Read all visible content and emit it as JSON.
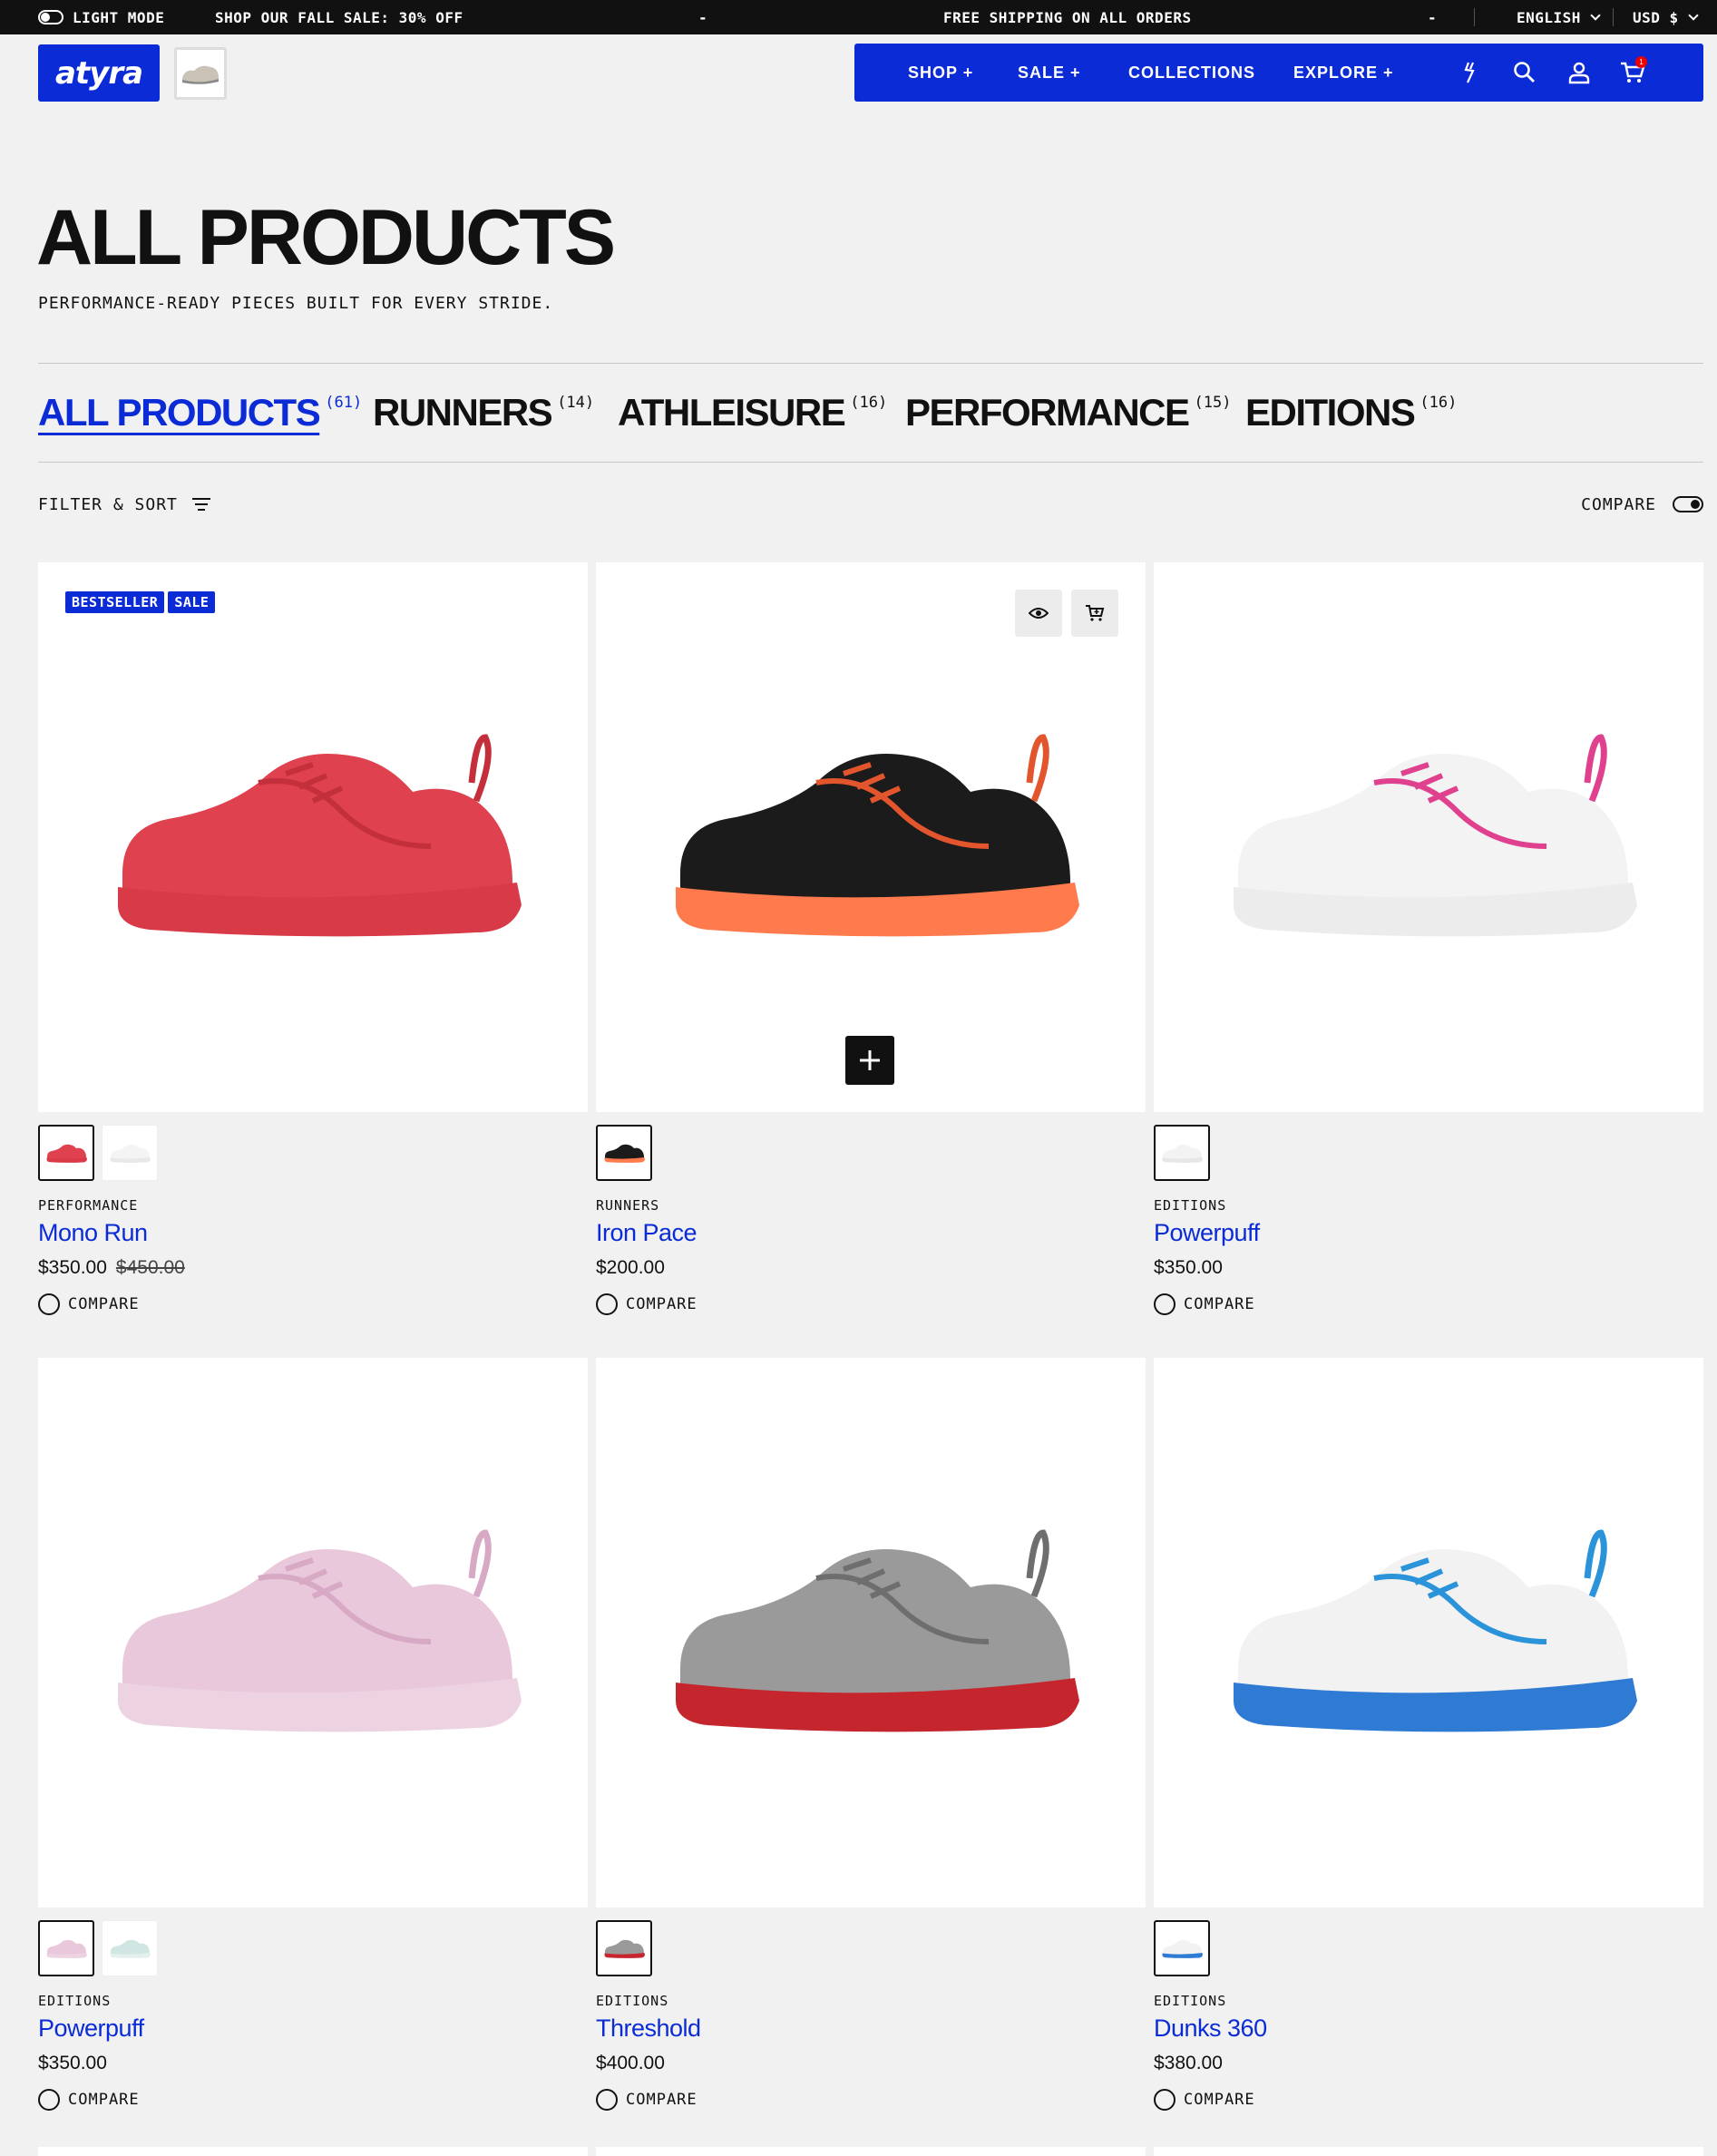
{
  "announcement": {
    "light_mode": "LIGHT MODE",
    "sale": "SHOP OUR FALL SALE: 30% OFF",
    "dash1": "-",
    "shipping": "FREE SHIPPING ON ALL ORDERS",
    "dash2": "-",
    "language": "ENGLISH",
    "currency": "USD $"
  },
  "header": {
    "logo_text": "atyra",
    "nav": [
      "SHOP +",
      "SALE +",
      "COLLECTIONS",
      "EXPLORE +"
    ],
    "cart_count": "1",
    "icons": [
      "lightning-icon",
      "search-icon",
      "account-icon",
      "cart-icon"
    ]
  },
  "page": {
    "title": "ALL PRODUCTS",
    "subtitle": "PERFORMANCE-READY PIECES BUILT FOR EVERY STRIDE."
  },
  "tabs": [
    {
      "label": "ALL PRODUCTS",
      "count": "(61)",
      "active": true
    },
    {
      "label": "RUNNERS",
      "count": "(14)",
      "active": false
    },
    {
      "label": "ATHLEISURE",
      "count": "(16)",
      "active": false
    },
    {
      "label": "PERFORMANCE",
      "count": "(15)",
      "active": false
    },
    {
      "label": "EDITIONS",
      "count": "(16)",
      "active": false
    }
  ],
  "toolbar": {
    "filter_label": "FILTER & SORT",
    "compare_label": "COMPARE"
  },
  "products": [
    {
      "category": "PERFORMANCE",
      "name": "Mono Run",
      "price": "$350.00",
      "old_price": "$450.00",
      "compare": "COMPARE",
      "badges": [
        "BESTSELLER",
        "SALE"
      ],
      "upper": "#e0414f",
      "sole": "#d83a47",
      "accent": "#c32f3b",
      "swatches": [
        [
          "#e0414f",
          "#d83a47"
        ],
        [
          "#f4f4f4",
          "#e8e8e8"
        ]
      ]
    },
    {
      "category": "RUNNERS",
      "name": "Iron Pace",
      "price": "$200.00",
      "old_price": "",
      "compare": "COMPARE",
      "badges": [],
      "upper": "#1b1b1b",
      "sole": "#ff7a4c",
      "accent": "#e2552d",
      "swatches": [
        [
          "#1b1b1b",
          "#ff7a4c"
        ]
      ]
    },
    {
      "category": "EDITIONS",
      "name": "Powerpuff",
      "price": "$350.00",
      "old_price": "",
      "compare": "COMPARE",
      "badges": [],
      "upper": "#f3f3f3",
      "sole": "#ececec",
      "accent": "#e0418f",
      "swatches": [
        [
          "#f3f3f3",
          "#e6e6e6"
        ]
      ]
    },
    {
      "category": "EDITIONS",
      "name": "Powerpuff",
      "price": "$350.00",
      "old_price": "",
      "compare": "COMPARE",
      "badges": [],
      "upper": "#e9c8dc",
      "sole": "#edd3e2",
      "accent": "#d7a9c4",
      "swatches": [
        [
          "#e9c8dc",
          "#edd3e2"
        ],
        [
          "#cfe6e2",
          "#e3f0ee"
        ]
      ]
    },
    {
      "category": "EDITIONS",
      "name": "Threshold",
      "price": "$400.00",
      "old_price": "",
      "compare": "COMPARE",
      "badges": [],
      "upper": "#9a9a9a",
      "sole": "#c5262d",
      "accent": "#6e6e6e",
      "swatches": [
        [
          "#9a9a9a",
          "#c5262d"
        ]
      ]
    },
    {
      "category": "EDITIONS",
      "name": "Dunks 360",
      "price": "$380.00",
      "old_price": "",
      "compare": "COMPARE",
      "badges": [],
      "upper": "#f2f2f2",
      "sole": "#2f7bd4",
      "accent": "#2a93d9",
      "swatches": [
        [
          "#f2f2f2",
          "#2f7bd4"
        ]
      ]
    }
  ]
}
